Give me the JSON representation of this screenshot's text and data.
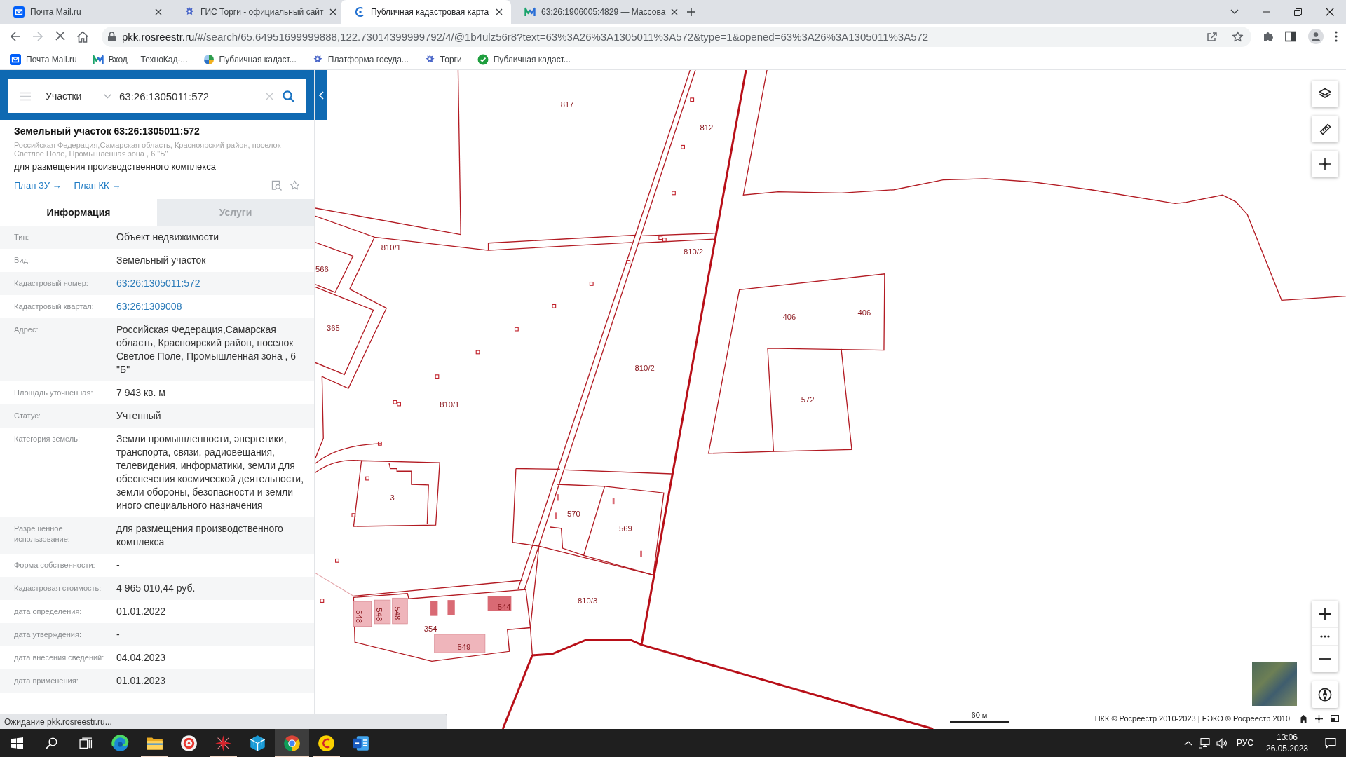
{
  "browser": {
    "tabs": [
      {
        "title": "Почта Mail.ru",
        "kind": "mail",
        "selected": false
      },
      {
        "title": "ГИС Торги - официальный сайт",
        "kind": "emblem",
        "selected": false
      },
      {
        "title": "Публичная кадастровая карта",
        "kind": "crescent",
        "selected": true
      },
      {
        "title": "63:26:1906005:4829 — Массова",
        "kind": "zigzag",
        "selected": false
      }
    ],
    "navigation": [
      {
        "kind": "back",
        "disabled": false
      },
      {
        "kind": "forward",
        "disabled": true
      },
      {
        "kind": "stop",
        "disabled": false
      },
      {
        "kind": "home",
        "disabled": false
      }
    ],
    "url": {
      "host": "pkk.rosreestr.ru",
      "rest": "/#/search/65.64951699999888,122.73014399999792/4/@1b4ulz56r8?text=63%3A26%3A1305011%3A572&type=1&opened=63%3A26%3A1305011%3A572"
    },
    "bookmarks": [
      {
        "title": "Почта Mail.ru",
        "kind": "mail"
      },
      {
        "title": "Вход — ТехноКад-...",
        "kind": "zigzag"
      },
      {
        "title": "Публичная кадаст...",
        "kind": "pie"
      },
      {
        "title": "Платформа госуда...",
        "kind": "emblem"
      },
      {
        "title": "Торги",
        "kind": "emblem"
      },
      {
        "title": "Публичная кадаст...",
        "kind": "check"
      }
    ]
  },
  "panel": {
    "search": {
      "layer": "Участки",
      "value": "63:26:1305011:572"
    },
    "title": "Земельный участок 63:26:1305011:572",
    "address": "Российская Федерация,Самарская область, Красноярский район, поселок Светлое Поле, Промышленная зона , 6 \"Б\"",
    "purpose": "для размещения производственного комплекса",
    "links": [
      "План ЗУ →",
      "План КК →"
    ],
    "tabs": [
      {
        "label": "Информация",
        "selected": true
      },
      {
        "label": "Услуги",
        "selected": false
      }
    ],
    "rows": [
      {
        "label": "Тип:",
        "value": "Объект недвижимости",
        "kind": "text"
      },
      {
        "label": "Вид:",
        "value": "Земельный участок",
        "kind": "text"
      },
      {
        "label": "Кадастровый номер:",
        "value": "63:26:1305011:572",
        "kind": "link"
      },
      {
        "label": "Кадастровый квартал:",
        "value": "63:26:1309008",
        "kind": "link"
      },
      {
        "label": "Адрес:",
        "value": "Российская Федерация,Самарская область, Красноярский район, поселок Светлое Поле, Промышленная зона , 6 \"Б\"",
        "kind": "text"
      },
      {
        "label": "Площадь уточненная:",
        "value": "7 943 кв. м",
        "kind": "text"
      },
      {
        "label": "Статус:",
        "value": "Учтенный",
        "kind": "text"
      },
      {
        "label": "Категория земель:",
        "value": "Земли промышленности, энергетики, транспорта, связи, радиовещания, телевидения, информатики, земли для обеспечения космической деятельности, земли обороны, безопасности и земли иного специального назначения",
        "kind": "text"
      },
      {
        "label": "Разрешенное использование:",
        "value": "для размещения производственного комплекса",
        "kind": "text"
      },
      {
        "label": "Форма собственности:",
        "value": "-",
        "kind": "text"
      },
      {
        "label": "Кадастровая стоимость:",
        "value": "4 965 010,44 руб.",
        "kind": "text"
      },
      {
        "label": "дата определения:",
        "value": "01.01.2022",
        "kind": "text"
      },
      {
        "label": "дата утверждения:",
        "value": "-",
        "kind": "text"
      },
      {
        "label": "дата внесения сведений:",
        "value": "04.04.2023",
        "kind": "text"
      },
      {
        "label": "дата применения:",
        "value": "01.01.2023",
        "kind": "text"
      }
    ]
  },
  "map": {
    "parcel_labels": [
      "817",
      "812",
      "810/1",
      "810/2",
      "566",
      "406",
      "406",
      "365",
      "810/2",
      "572",
      "810/1",
      "3",
      "570",
      "569",
      "810/3",
      "544",
      "548",
      "548",
      "548",
      "354",
      "549"
    ],
    "scale": "60 м",
    "attribution": "ПКК © Росреестр 2010-2023 | ЕЭКО © Росреестр 2010"
  },
  "status": "Ожидание pkk.rosreestr.ru...",
  "taskbar": {
    "buttons": [
      {
        "kind": "start",
        "selected": false,
        "running": false
      },
      {
        "kind": "search",
        "selected": false,
        "running": false
      },
      {
        "kind": "taskview",
        "selected": false,
        "running": false
      },
      {
        "kind": "edge",
        "selected": false,
        "running": false
      },
      {
        "kind": "explorer",
        "selected": false,
        "running": true
      },
      {
        "kind": "yandex",
        "selected": false,
        "running": false
      },
      {
        "kind": "redstar",
        "selected": false,
        "running": true
      },
      {
        "kind": "cube",
        "selected": false,
        "running": false
      },
      {
        "kind": "chrome",
        "selected": true,
        "running": true
      },
      {
        "kind": "onec",
        "selected": false,
        "running": true
      },
      {
        "kind": "word",
        "selected": false,
        "running": false
      }
    ],
    "language": "РУС",
    "time": "13:06",
    "date": "26.05.2023"
  }
}
